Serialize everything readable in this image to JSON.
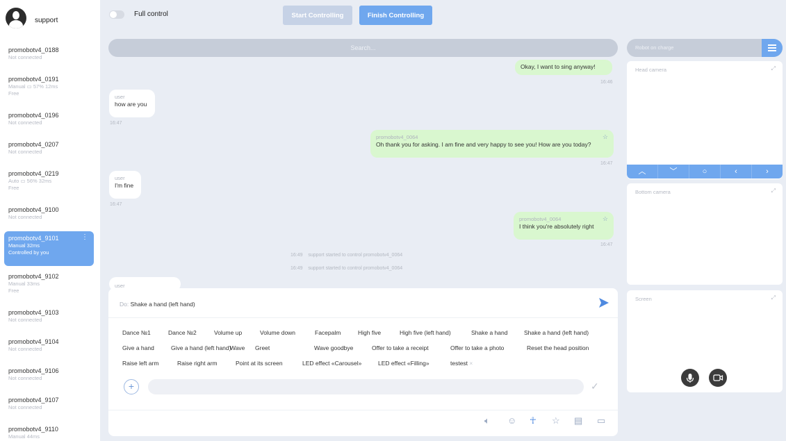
{
  "user": {
    "name": "support"
  },
  "robots": [
    {
      "name": "promobotv4_0188",
      "status": "Not connected",
      "extra": ""
    },
    {
      "name": "promobotv4_0191",
      "status": "Manual  ▭ 57%  12ms",
      "extra": "Free"
    },
    {
      "name": "promobotv4_0196",
      "status": "Not connected",
      "extra": ""
    },
    {
      "name": "promobotv4_0207",
      "status": "Not connected",
      "extra": ""
    },
    {
      "name": "promobotv4_0219",
      "status": "Auto  ▭ 56%  32ms",
      "extra": "Free"
    },
    {
      "name": "promobotv4_9100",
      "status": "Not connected",
      "extra": ""
    },
    {
      "name": "promobotv4_9101",
      "status": "Manual    32ms",
      "extra": "Controlled by you"
    },
    {
      "name": "promobotv4_9102",
      "status": "Manual    33ms",
      "extra": "Free"
    },
    {
      "name": "promobotv4_9103",
      "status": "Not connected",
      "extra": ""
    },
    {
      "name": "promobotv4_9104",
      "status": "Not connected",
      "extra": ""
    },
    {
      "name": "promobotv4_9106",
      "status": "Not connected",
      "extra": ""
    },
    {
      "name": "promobotv4_9107",
      "status": "Not connected",
      "extra": ""
    },
    {
      "name": "promobotv4_9110",
      "status": "Manual    44ms",
      "extra": ""
    }
  ],
  "topbar": {
    "full_control_label": "Full control",
    "start_label": "Start Controlling",
    "finish_label": "Finish Controlling"
  },
  "search": {
    "placeholder": "Search..."
  },
  "chat": [
    {
      "text": "Okay, I want to sing anyway!",
      "time": "16:46"
    },
    {
      "sender": "user",
      "text": "how are you",
      "time": "16:47"
    },
    {
      "sender": "promobotv4_0064",
      "text": "Oh thank you for asking. I am fine and very happy to see you! How are you today?",
      "time": "16:47"
    },
    {
      "sender": "user",
      "text": "I'm fine",
      "time": "16:47"
    },
    {
      "sender": "promobotv4_0064",
      "text": "I think you're absolutely right",
      "time": "16:47"
    },
    {
      "sender": "user"
    }
  ],
  "system_messages": [
    {
      "time": "16:49",
      "text": "support started to control promobotv4_0064"
    },
    {
      "time": "16:49",
      "text": "support started to control promobotv4_0064"
    }
  ],
  "input": {
    "do_prefix": "Do:",
    "do_value": "Shake a hand (left hand)"
  },
  "commands": [
    "Dance №1",
    "Dance №2",
    "Volume up",
    "Volume down",
    "Facepalm",
    "High five",
    "High five (left hand)",
    "Shake a hand",
    "Shake a hand (left hand)",
    "Give a hand",
    "Give a hand (left hand)",
    "Wave",
    "Greet",
    "Wave goodbye",
    "Offer to take a receipt",
    "Offer to take a photo",
    "Reset the head position",
    "Raise left arm",
    "Raise right arm",
    "Point at its screen",
    "LED effect «Carousel»",
    "LED effect «Filling»",
    "testest"
  ],
  "toolbar_icons": [
    "speaker-icon",
    "smile-icon",
    "person-icon",
    "star-icon",
    "script-icon",
    "monitor-icon"
  ],
  "right_panel": {
    "charge_label": "Robot on charge",
    "head_camera_label": "Head camera",
    "bottom_camera_label": "Bottom camera",
    "screen_label": "Screen"
  },
  "colors": {
    "accent": "#6fa7ee",
    "robot_bubble": "#d9f7cf"
  }
}
